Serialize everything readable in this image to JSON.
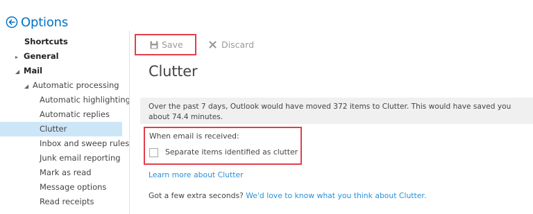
{
  "header": {
    "title": "Options",
    "back_icon": "back-arrow-circle-icon"
  },
  "sidebar": {
    "items": [
      {
        "label": "Shortcuts"
      },
      {
        "label": "General",
        "expander": "collapsed"
      },
      {
        "label": "Mail",
        "expander": "expanded"
      },
      {
        "label": "Automatic processing",
        "expander": "expanded"
      },
      {
        "label": "Automatic highlighting"
      },
      {
        "label": "Automatic replies"
      },
      {
        "label": "Clutter",
        "selected": true
      },
      {
        "label": "Inbox and sweep rules"
      },
      {
        "label": "Junk email reporting"
      },
      {
        "label": "Mark as read"
      },
      {
        "label": "Message options"
      },
      {
        "label": "Read receipts"
      }
    ]
  },
  "toolbar": {
    "save_label": "Save",
    "save_icon": "floppy-disk-icon",
    "discard_label": "Discard",
    "discard_icon": "x-icon"
  },
  "page": {
    "title": "Clutter",
    "notice": "Over the past 7 days, Outlook would have moved 372 items to Clutter. This would have saved you about 74.4 minutes.",
    "when_label": "When email is received:",
    "checkbox_label": "Separate items identified as clutter",
    "checkbox_checked": false,
    "learn_more": "Learn more about Clutter",
    "feedback_prefix": "Got a few extra seconds?",
    "feedback_link": "We'd love to know what you think about Clutter."
  },
  "colors": {
    "accent": "#0072c6",
    "link": "#2b8fd5",
    "highlight_box": "#e33d4a",
    "selected_bg": "#cde6f7",
    "notice_bg": "#f0f0f0"
  }
}
